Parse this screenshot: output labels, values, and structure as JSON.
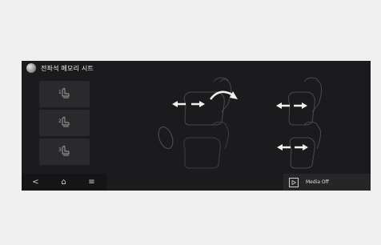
{
  "header": {
    "title": "전좌석 메모리 시트",
    "icon": "seat-icon"
  },
  "memory_buttons": [
    {
      "label": "1",
      "icon": "seat-memory-icon"
    },
    {
      "label": "2",
      "icon": "seat-memory-icon"
    },
    {
      "label": "3",
      "icon": "seat-memory-icon"
    }
  ],
  "bottom_nav": {
    "back_label": "<",
    "home_label": "⌂",
    "menu_label": "≡"
  },
  "media": {
    "status_text": "Media Off",
    "icon": "play-icon"
  },
  "colors": {
    "screen_bg": "#1b1b1d",
    "button_bg": "#2a2a2d",
    "accent": "#ffffff"
  }
}
